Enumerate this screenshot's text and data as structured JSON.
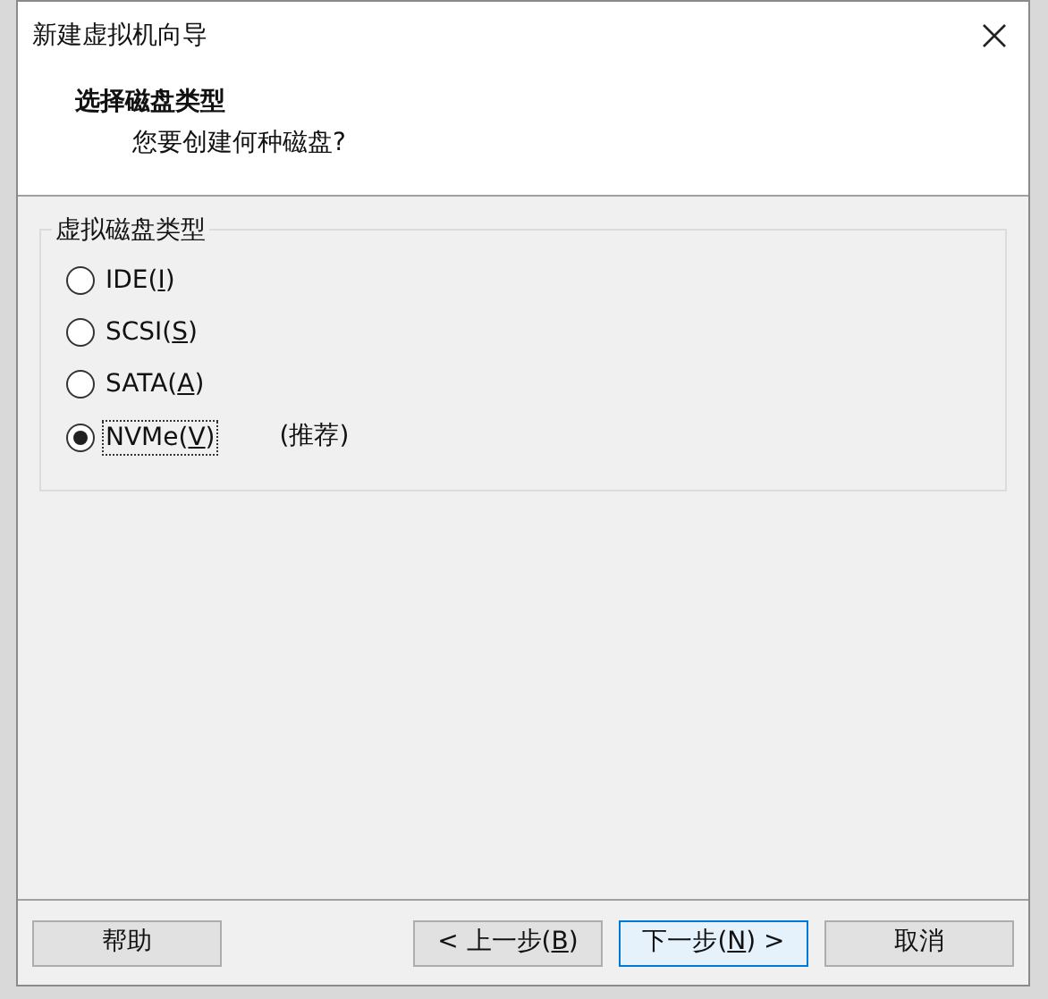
{
  "window": {
    "title": "新建虚拟机向导"
  },
  "header": {
    "title": "选择磁盘类型",
    "subtitle": "您要创建何种磁盘?"
  },
  "group": {
    "title": "虚拟磁盘类型",
    "options": [
      {
        "text": "IDE(",
        "accel": "I",
        "suffix": ")",
        "selected": false
      },
      {
        "text": "SCSI(",
        "accel": "S",
        "suffix": ")",
        "selected": false
      },
      {
        "text": "SATA(",
        "accel": "A",
        "suffix": ")",
        "selected": false
      },
      {
        "text": "NVMe(",
        "accel": "V",
        "suffix": ")",
        "selected": true,
        "note": "(推荐)"
      }
    ]
  },
  "buttons": [
    {
      "kind": "help",
      "text": "帮助"
    },
    {
      "kind": "back",
      "text": "< 上一步(",
      "accel": "B",
      "suffix": ")"
    },
    {
      "kind": "next",
      "text": "下一步(",
      "accel": "N",
      "suffix": ") >"
    },
    {
      "kind": "cancel",
      "text": "取消"
    }
  ]
}
